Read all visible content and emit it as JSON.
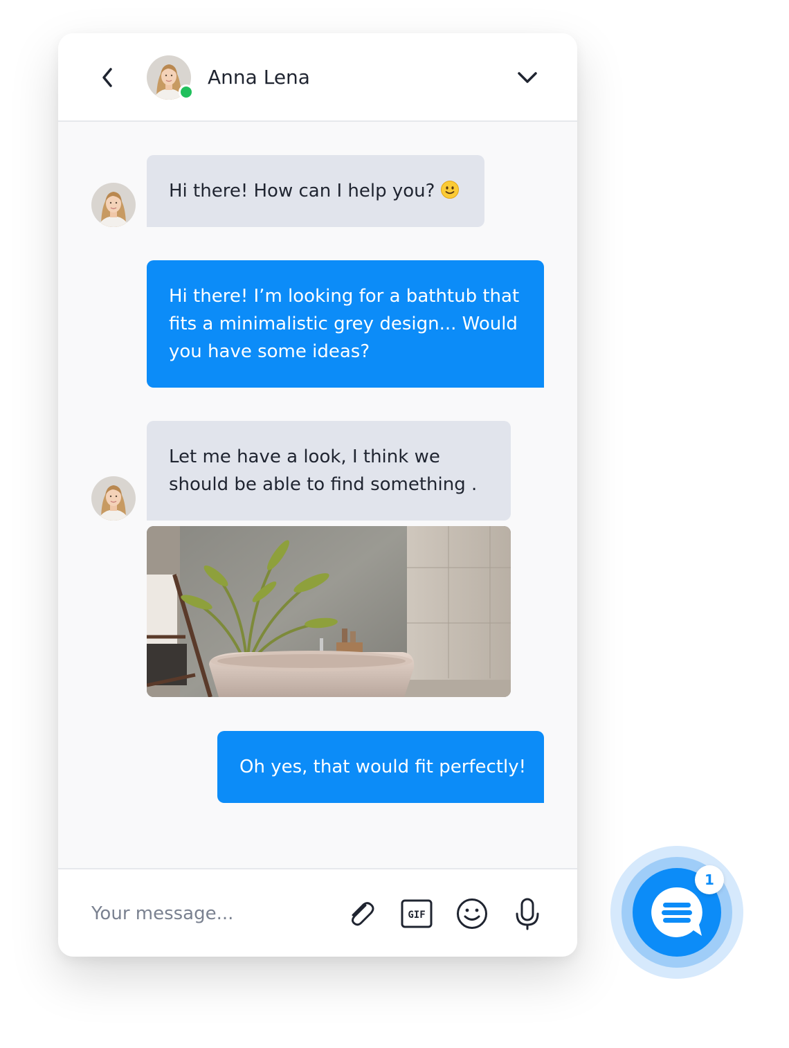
{
  "header": {
    "contact_name": "Anna Lena",
    "status": "online",
    "status_color": "#20c05c"
  },
  "messages": [
    {
      "from": "agent",
      "text": "Hi there! How can I help you?",
      "emoji": "slightly-smiling-face"
    },
    {
      "from": "user",
      "lines": [
        "Hi there! I’m looking for a bathtub that",
        "fits a minimalistic grey design... Would",
        "you have some ideas?"
      ]
    },
    {
      "from": "agent",
      "lines": [
        "Let me have a look, I think we",
        "should be able to find something ."
      ],
      "attachment": "bathtub-photo"
    },
    {
      "from": "user",
      "text": "Oh yes, that would fit perfectly!"
    }
  ],
  "composer": {
    "placeholder": "Your message...",
    "tools": [
      "paperclip-icon",
      "gif-icon",
      "emoji-icon",
      "microphone-icon"
    ],
    "gif_label": "GIF"
  },
  "launcher": {
    "unread_count": "1",
    "icon": "chat-bubble-icon"
  },
  "colors": {
    "accent": "#0c8cf8",
    "agent_bubble": "#e1e4ec",
    "text": "#1f2430"
  }
}
